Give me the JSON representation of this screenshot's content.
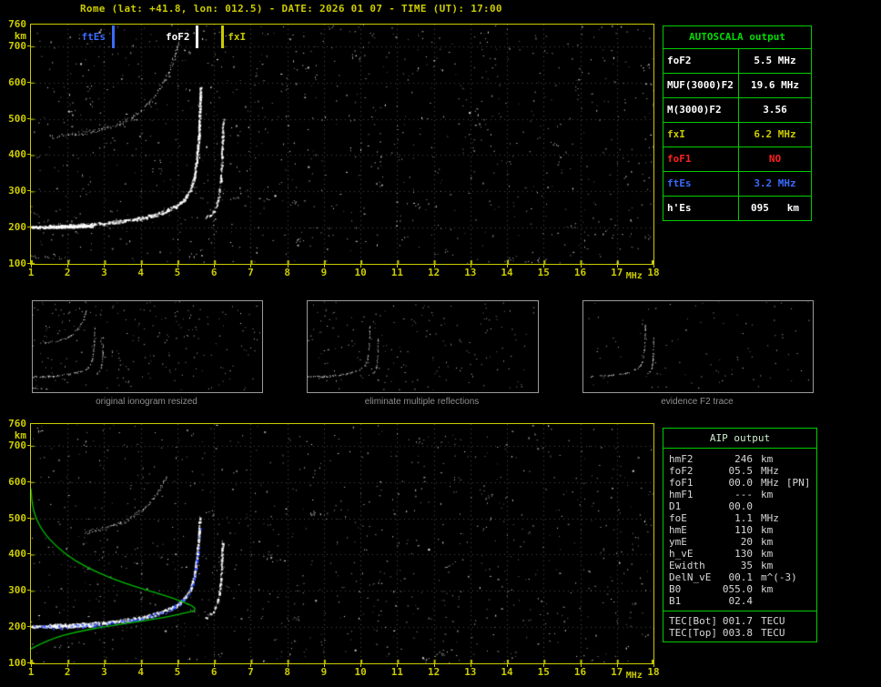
{
  "header": {
    "title": "Rome (lat: +41.8, lon: 012.5) - DATE: 2026 01 07 - TIME (UT): 17:00"
  },
  "colors": {
    "axis_yellow": "#cccc00",
    "panel_green": "#00cc00",
    "marker_blue": "#3a6bff",
    "alert_red": "#ff2020",
    "trace_white": "#ffffff",
    "fitted_trace_blue": "#2a4fff",
    "profile_green": "#00bb00",
    "caption_gray": "#8f8f8f"
  },
  "autoscala": {
    "title": "AUTOSCALA output",
    "rows": [
      {
        "label": "foF2",
        "value": "5.5 MHz",
        "color": "#ffffff"
      },
      {
        "label": "MUF(3000)F2",
        "value": "19.6 MHz",
        "color": "#ffffff"
      },
      {
        "label": "M(3000)F2",
        "value": "3.56",
        "color": "#ffffff"
      },
      {
        "label": "fxI",
        "value": "6.2 MHz",
        "color": "#cccc00"
      },
      {
        "label": "foF1",
        "value": "NO",
        "color": "#ff2020"
      },
      {
        "label": "ftEs",
        "value": "3.2 MHz",
        "color": "#3a6bff"
      },
      {
        "label": "h'Es",
        "value": "095   km",
        "color": "#ffffff"
      }
    ]
  },
  "thumbnails": [
    {
      "caption": "original ionogram resized"
    },
    {
      "caption": "eliminate multiple reflections"
    },
    {
      "caption": "evidence F2 trace"
    }
  ],
  "aip": {
    "title": "AIP output",
    "rows": [
      {
        "label": "hmF2",
        "value": "246",
        "unit": "km",
        "note": ""
      },
      {
        "label": "foF2",
        "value": "05.5",
        "unit": "MHz",
        "note": ""
      },
      {
        "label": "foF1",
        "value": "00.0",
        "unit": "MHz",
        "note": "[PN]"
      },
      {
        "label": "hmF1",
        "value": "---",
        "unit": "km",
        "note": ""
      },
      {
        "label": "D1",
        "value": "00.0",
        "unit": "",
        "note": ""
      },
      {
        "label": "foE",
        "value": "1.1",
        "unit": "MHz",
        "note": ""
      },
      {
        "label": "hmE",
        "value": "110",
        "unit": "km",
        "note": ""
      },
      {
        "label": "ymE",
        "value": "20",
        "unit": "km",
        "note": ""
      },
      {
        "label": "h_vE",
        "value": "130",
        "unit": "km",
        "note": ""
      },
      {
        "label": "Ewidth",
        "value": "35",
        "unit": "km",
        "note": ""
      },
      {
        "label": "DelN_vE",
        "value": "00.1",
        "unit": "m^(-3)",
        "note": ""
      },
      {
        "label": "B0",
        "value": "055.0",
        "unit": "km",
        "note": ""
      },
      {
        "label": "B1",
        "value": "02.4",
        "unit": "",
        "note": ""
      }
    ],
    "tec_rows": [
      {
        "label": "TEC[Bot]",
        "value": "001.7",
        "unit": "TECU"
      },
      {
        "label": "TEC[Top]",
        "value": "003.8",
        "unit": "TECU"
      }
    ]
  },
  "chart_data": [
    {
      "id": "ionogram_top",
      "type": "scatter",
      "title": "ionogram with autoscaled characteristic frequencies",
      "xlabel": "MHz",
      "ylabel": "km",
      "xlim": [
        1,
        18
      ],
      "ylim": [
        100,
        760
      ],
      "xticks": [
        1,
        2,
        3,
        4,
        5,
        6,
        7,
        8,
        9,
        10,
        11,
        12,
        13,
        14,
        15,
        16,
        17,
        18
      ],
      "yticks": [
        760,
        700,
        600,
        500,
        400,
        300,
        200,
        100
      ],
      "grid": true,
      "markers": [
        {
          "label": "ftEs",
          "freq_mhz": 3.2,
          "color": "#3a6bff",
          "label_side": "left"
        },
        {
          "label": "foF2",
          "freq_mhz": 5.5,
          "color": "#ffffff",
          "label_side": "left"
        },
        {
          "label": "fxI",
          "freq_mhz": 6.2,
          "color": "#cccc00",
          "label_side": "right"
        }
      ],
      "traces": {
        "f2_ordinary": [
          [
            1.5,
            205
          ],
          [
            2.0,
            206
          ],
          [
            2.5,
            209
          ],
          [
            3.0,
            213
          ],
          [
            3.5,
            219
          ],
          [
            4.0,
            227
          ],
          [
            4.4,
            237
          ],
          [
            4.7,
            248
          ],
          [
            5.0,
            262
          ],
          [
            5.2,
            281
          ],
          [
            5.35,
            306
          ],
          [
            5.45,
            342
          ],
          [
            5.52,
            392
          ],
          [
            5.57,
            452
          ],
          [
            5.6,
            522
          ],
          [
            5.62,
            590
          ]
        ],
        "f2_extraordinary": [
          [
            5.78,
            228
          ],
          [
            5.95,
            241
          ],
          [
            6.05,
            259
          ],
          [
            6.12,
            286
          ],
          [
            6.17,
            327
          ],
          [
            6.2,
            382
          ],
          [
            6.22,
            442
          ],
          [
            6.24,
            500
          ]
        ],
        "f2_second_hop": [
          [
            1.5,
            450
          ],
          [
            2.0,
            456
          ],
          [
            2.5,
            463
          ],
          [
            3.0,
            473
          ],
          [
            3.4,
            486
          ],
          [
            3.8,
            506
          ],
          [
            4.1,
            531
          ],
          [
            4.4,
            566
          ],
          [
            4.7,
            616
          ],
          [
            4.9,
            666
          ],
          [
            5.05,
            722
          ]
        ],
        "es_second_reflection": [
          [
            1.0,
            202
          ],
          [
            1.6,
            203
          ],
          [
            2.2,
            204
          ],
          [
            2.7,
            205
          ]
        ],
        "es_layer": [
          [
            1.0,
            122
          ],
          [
            1.6,
            117
          ],
          [
            2.2,
            113
          ]
        ]
      },
      "noise_dots": 950
    },
    {
      "id": "ionogram_bottom",
      "type": "scatter",
      "title": "ionogram with autoscaled trace and electron density profile",
      "xlabel": "MHz",
      "ylabel": "km",
      "xlim": [
        1,
        18
      ],
      "ylim": [
        100,
        760
      ],
      "xticks": [
        1,
        2,
        3,
        4,
        5,
        6,
        7,
        8,
        9,
        10,
        11,
        12,
        13,
        14,
        15,
        16,
        17,
        18
      ],
      "yticks": [
        760,
        700,
        600,
        500,
        400,
        300,
        200,
        100
      ],
      "grid": true,
      "traces": {
        "f2_ordinary": [
          [
            1.5,
            205
          ],
          [
            2.0,
            206
          ],
          [
            2.5,
            209
          ],
          [
            3.0,
            213
          ],
          [
            3.5,
            219
          ],
          [
            4.0,
            227
          ],
          [
            4.4,
            237
          ],
          [
            4.7,
            248
          ],
          [
            5.0,
            262
          ],
          [
            5.2,
            281
          ],
          [
            5.35,
            306
          ],
          [
            5.45,
            342
          ],
          [
            5.52,
            392
          ],
          [
            5.57,
            452
          ],
          [
            5.6,
            505
          ]
        ],
        "f2_extraordinary": [
          [
            5.78,
            228
          ],
          [
            5.95,
            241
          ],
          [
            6.05,
            259
          ],
          [
            6.12,
            286
          ],
          [
            6.17,
            327
          ],
          [
            6.2,
            382
          ],
          [
            6.22,
            440
          ]
        ],
        "f2_second_hop": [
          [
            2.5,
            463
          ],
          [
            3.0,
            473
          ],
          [
            3.4,
            486
          ],
          [
            3.8,
            506
          ],
          [
            4.1,
            531
          ],
          [
            4.4,
            566
          ],
          [
            4.7,
            616
          ]
        ],
        "es_second_reflection": [
          [
            1.0,
            202
          ],
          [
            1.6,
            203
          ],
          [
            2.2,
            204
          ],
          [
            2.7,
            205
          ]
        ]
      },
      "autoscaled_trace": [
        [
          1.1,
          200
        ],
        [
          1.7,
          201
        ],
        [
          2.3,
          204
        ],
        [
          2.9,
          208
        ],
        [
          3.5,
          215
        ],
        [
          4.1,
          226
        ],
        [
          4.6,
          241
        ],
        [
          5.0,
          261
        ],
        [
          5.2,
          280
        ],
        [
          5.35,
          305
        ],
        [
          5.45,
          338
        ],
        [
          5.52,
          380
        ],
        [
          5.57,
          430
        ],
        [
          5.6,
          478
        ]
      ],
      "electron_density_profile": [
        [
          1.0,
          140
        ],
        [
          1.5,
          166
        ],
        [
          2.2,
          186
        ],
        [
          3.0,
          201
        ],
        [
          3.8,
          213
        ],
        [
          4.5,
          224
        ],
        [
          5.0,
          234
        ],
        [
          5.3,
          241
        ],
        [
          5.5,
          246
        ],
        [
          5.45,
          256
        ],
        [
          5.2,
          268
        ],
        [
          4.8,
          282
        ],
        [
          4.2,
          301
        ],
        [
          3.5,
          323
        ],
        [
          2.8,
          351
        ],
        [
          2.2,
          383
        ],
        [
          1.7,
          421
        ],
        [
          1.3,
          466
        ],
        [
          1.05,
          521
        ],
        [
          1.0,
          582
        ]
      ],
      "noise_dots": 850
    }
  ]
}
